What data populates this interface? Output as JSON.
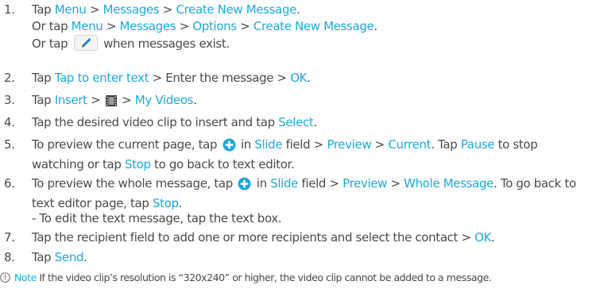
{
  "steps": [
    {
      "num": "1.",
      "line1": [
        "Tap ",
        "Menu",
        " > ",
        "Messages",
        " > ",
        "Create New Message",
        "."
      ],
      "line2": [
        "Or tap ",
        "Menu",
        " > ",
        "Messages",
        " > ",
        "Options",
        " > ",
        "Create New Message",
        "."
      ],
      "line3": [
        "Or tap ",
        " when messages exist."
      ]
    },
    {
      "num": "2.",
      "parts": [
        "Tap ",
        "Tap to enter text",
        " > Enter the message > ",
        "OK",
        "."
      ]
    },
    {
      "num": "3.",
      "parts": [
        "Tap ",
        "Insert",
        " > ",
        " > ",
        "My Videos",
        "."
      ]
    },
    {
      "num": "4.",
      "parts": [
        "Tap the desired video clip to insert and tap ",
        "Select",
        "."
      ]
    },
    {
      "num": "5.",
      "parts": [
        "To preview the current page, tap ",
        " in ",
        "Slide",
        " field > ",
        "Preview",
        " > ",
        "Current",
        ". Tap ",
        "Pause",
        " to stop watching or tap ",
        "Stop",
        " to go back to text editor."
      ]
    },
    {
      "num": "6.",
      "parts": [
        "To preview the whole message, tap ",
        " in ",
        "Slide",
        " field > ",
        "Preview",
        " > ",
        "Whole Message",
        ". To go back to text editor page, tap ",
        "Stop",
        "."
      ]
    },
    {
      "num": "7.",
      "parts": [
        "Tap the recipient field to add one or more recipients and select the contact > ",
        "OK",
        "."
      ]
    },
    {
      "num": "8.",
      "parts": [
        "Tap ",
        "Send",
        "."
      ]
    }
  ],
  "sub_note": "- To edit the text message, tap the text box.",
  "note": {
    "label": "Note",
    "text": " If the video clip’s resolution is “320x240” or higher, the video clip cannot be added to a message."
  },
  "icons": [
    "pencil-icon",
    "film-icon",
    "add-circle-icon",
    "info-circle-icon"
  ],
  "colors": {
    "text": "#4a4a4a",
    "highlight": "#1ea8e0"
  }
}
